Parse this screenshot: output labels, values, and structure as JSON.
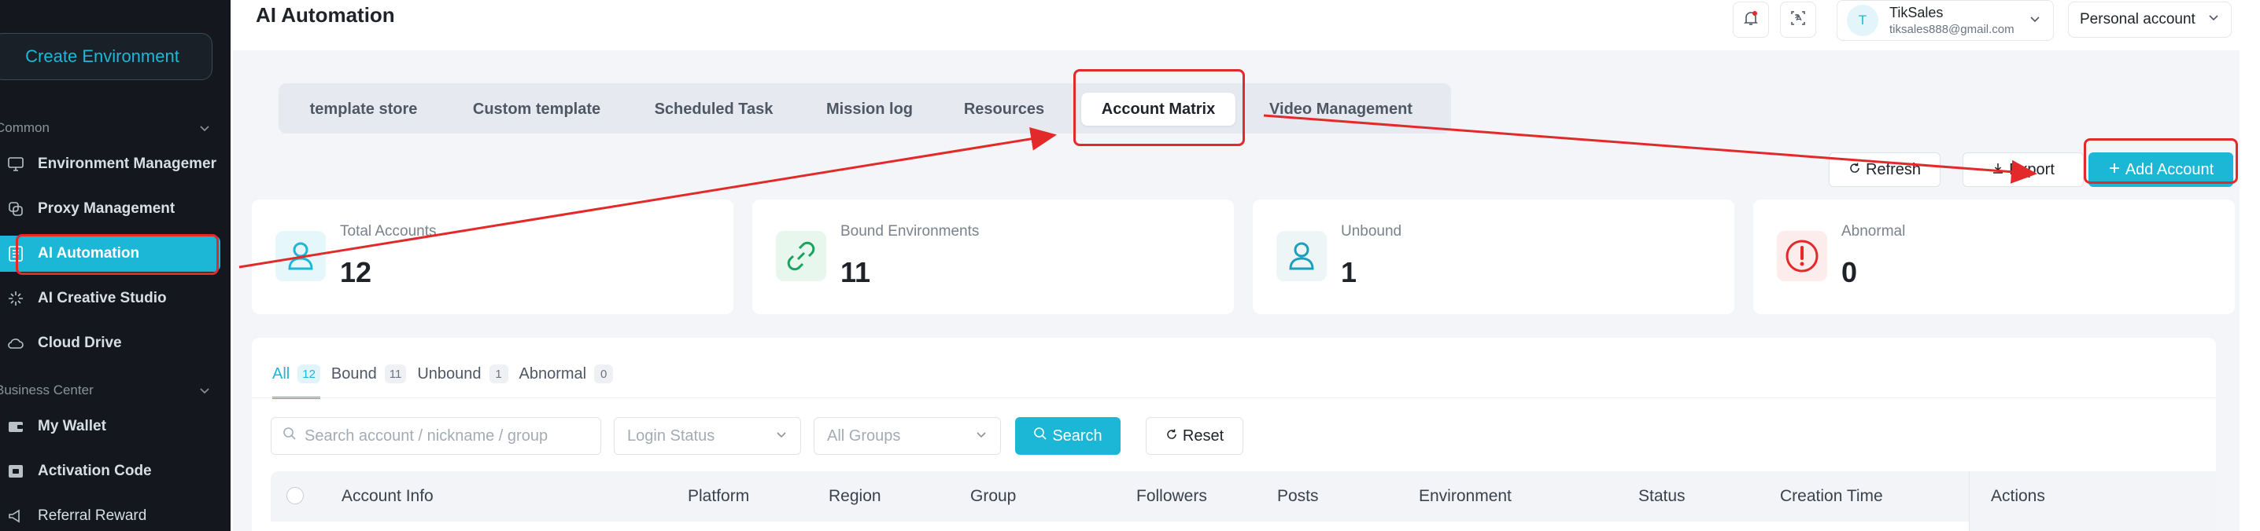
{
  "sidebar": {
    "create_label": "Create Environment",
    "sections": {
      "common": "Common",
      "business": "Business Center"
    },
    "items": [
      {
        "label": "Environment Managemer",
        "icon": "monitor-icon"
      },
      {
        "label": "Proxy Management",
        "icon": "proxy-icon"
      },
      {
        "label": "AI Automation",
        "icon": "ai-automation-icon"
      },
      {
        "label": "AI Creative Studio",
        "icon": "sparkle-icon"
      },
      {
        "label": "Cloud Drive",
        "icon": "cloud-icon"
      },
      {
        "label": "My Wallet",
        "icon": "wallet-icon"
      },
      {
        "label": "Activation Code",
        "icon": "activation-code-icon"
      },
      {
        "label": "Referral Reward",
        "icon": "megaphone-icon"
      }
    ]
  },
  "header": {
    "title": "AI Automation",
    "user": {
      "initial": "T",
      "name": "TikSales",
      "email": "tiksales888@gmail.com"
    },
    "account_type": "Personal account"
  },
  "tabs": [
    {
      "label": "template store"
    },
    {
      "label": "Custom template"
    },
    {
      "label": "Scheduled Task"
    },
    {
      "label": "Mission log"
    },
    {
      "label": "Resources"
    },
    {
      "label": "Account Matrix"
    },
    {
      "label": "Video Management"
    }
  ],
  "actions": {
    "refresh": "Refresh",
    "export": "Export",
    "add": "Add Account"
  },
  "stats": [
    {
      "label": "Total Accounts",
      "value": "12"
    },
    {
      "label": "Bound Environments",
      "value": "11"
    },
    {
      "label": "Unbound",
      "value": "1"
    },
    {
      "label": "Abnormal",
      "value": "0"
    }
  ],
  "filters": [
    {
      "label": "All",
      "count": "12"
    },
    {
      "label": "Bound",
      "count": "11"
    },
    {
      "label": "Unbound",
      "count": "1"
    },
    {
      "label": "Abnormal",
      "count": "0"
    }
  ],
  "search": {
    "placeholder": "Search account / nickname / group",
    "login_status": "Login Status",
    "groups": "All Groups",
    "search_label": "Search",
    "reset_label": "Reset"
  },
  "table": {
    "columns": [
      "Account Info",
      "Platform",
      "Region",
      "Group",
      "Followers",
      "Posts",
      "Environment",
      "Status",
      "Creation Time",
      "Actions"
    ]
  },
  "colors": {
    "accent": "#1cb7d6",
    "annotation": "#e32a2a",
    "sidebar_bg": "#14181e"
  }
}
